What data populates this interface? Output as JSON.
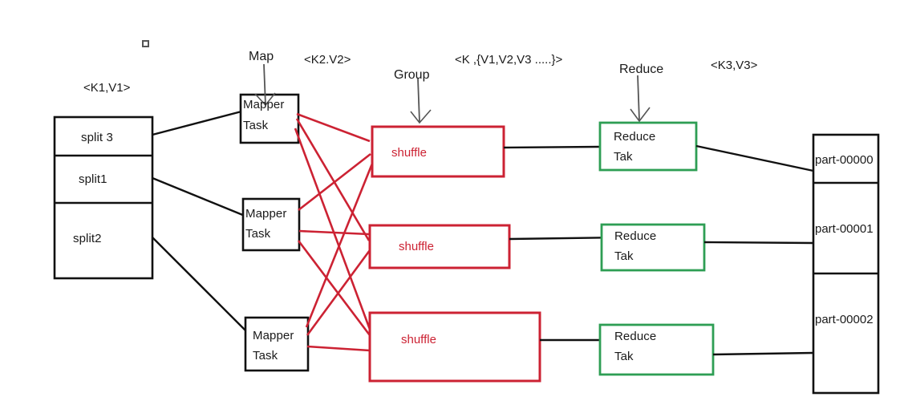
{
  "diagram": {
    "title": "MapReduce data flow diagram",
    "colors": {
      "black": "#111111",
      "red": "#cc2233",
      "green": "#2e9e54",
      "arrow_gray": "#555555",
      "background": "#ffffff"
    }
  },
  "annotations": {
    "k1v1": "<K1,V1>",
    "map": "Map",
    "k2v2": "<K2.V2>",
    "group": "Group",
    "k_list": "<K  ,{V1,V2,V3 .....}>",
    "reduce": "Reduce",
    "k3v3": "<K3,V3>"
  },
  "input_splits": {
    "name": "input-splits",
    "items": [
      {
        "label": "split 3"
      },
      {
        "label": "split1"
      },
      {
        "label": "split2"
      }
    ]
  },
  "mappers": [
    {
      "line1": "Mapper",
      "line2": "Task"
    },
    {
      "line1": "Mapper",
      "line2": "Task"
    },
    {
      "line1": "Mapper",
      "line2": "Task"
    }
  ],
  "shuffles": [
    {
      "label": "shuffle"
    },
    {
      "label": "shuffle"
    },
    {
      "label": "shuffle"
    }
  ],
  "reducers": [
    {
      "line1": "Reduce",
      "line2": "Tak"
    },
    {
      "line1": "Reduce",
      "line2": "Tak"
    },
    {
      "line1": "Reduce",
      "line2": "Tak"
    }
  ],
  "outputs": {
    "name": "output-partitions",
    "items": [
      {
        "label": "part-00000"
      },
      {
        "label": "part-00001"
      },
      {
        "label": "part-00002"
      }
    ]
  }
}
